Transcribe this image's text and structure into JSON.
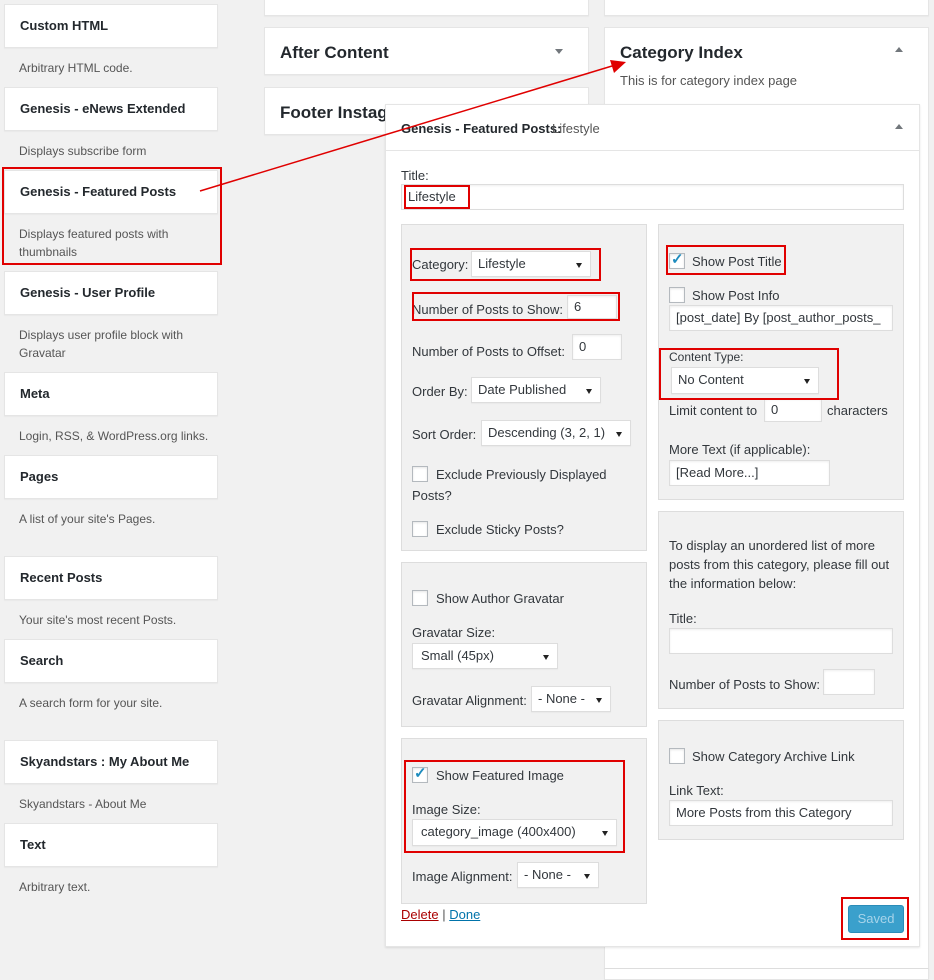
{
  "sidebar": {
    "widgets": [
      {
        "title": "Custom HTML",
        "desc": "Arbitrary HTML code."
      },
      {
        "title": "Genesis - eNews Extended",
        "desc": "Displays subscribe form"
      },
      {
        "title": "Genesis - Featured Posts",
        "desc": "Displays featured posts with thumbnails"
      },
      {
        "title": "Genesis - User Profile",
        "desc": "Displays user profile block with Gravatar"
      },
      {
        "title": "Meta",
        "desc": "Login, RSS, & WordPress.org links."
      },
      {
        "title": "Pages",
        "desc": "A list of your site's Pages."
      },
      {
        "title": "Recent Posts",
        "desc": "Your site's most recent Posts."
      },
      {
        "title": "Search",
        "desc": "A search form for your site."
      },
      {
        "title": "Skyandstars : My About Me",
        "desc": "Skyandstars - About Me"
      },
      {
        "title": "Text",
        "desc": "Arbitrary text."
      }
    ]
  },
  "areas": {
    "after_content": "After Content",
    "footer_instagram": "Footer Instagram",
    "category_index": "Category Index",
    "category_index_desc": "This is for category index page"
  },
  "panel": {
    "header": "Genesis - Featured Posts:",
    "header_value": "Lifestyle",
    "title_label": "Title:",
    "title_value": "Lifestyle",
    "category_label": "Category:",
    "category_value": "Lifestyle",
    "num_posts_label": "Number of Posts to Show:",
    "num_posts_value": "6",
    "offset_label": "Number of Posts to Offset:",
    "offset_value": "0",
    "order_by_label": "Order By:",
    "order_by_value": "Date Published",
    "sort_order_label": "Sort Order:",
    "sort_order_value": "Descending (3, 2, 1)",
    "exclude_prev_label_1": "Exclude Previously Displayed",
    "exclude_prev_label_2": "Posts?",
    "exclude_sticky_label": "Exclude Sticky Posts?",
    "show_gravatar_label": "Show Author Gravatar",
    "gravatar_size_label": "Gravatar Size:",
    "gravatar_size_value": "Small (45px)",
    "gravatar_align_label": "Gravatar Alignment:",
    "gravatar_align_value": "- None -",
    "show_featured_label": "Show Featured Image",
    "image_size_label": "Image Size:",
    "image_size_value": "category_image (400x400)",
    "image_align_label": "Image Alignment:",
    "image_align_value": "- None -",
    "show_post_title_label": "Show Post Title",
    "show_post_info_label": "Show Post Info",
    "post_info_value": "[post_date] By [post_author_posts_",
    "content_type_label": "Content Type:",
    "content_type_value": "No Content",
    "limit_label": "Limit content to",
    "limit_value": "0",
    "limit_suffix": "characters",
    "more_text_label": "More Text (if applicable):",
    "more_text_value": "[Read More...]",
    "more_list_desc_1": "To display an unordered list of more",
    "more_list_desc_2": "posts from this category, please fill out",
    "more_list_desc_3": "the information below:",
    "more_title_label": "Title:",
    "more_num_label": "Number of Posts to Show:",
    "archive_link_label": "Show Category Archive Link",
    "link_text_label": "Link Text:",
    "link_text_value": "More Posts from this Category",
    "delete_label": "Delete",
    "separator": "|",
    "done_label": "Done",
    "saved_label": "Saved"
  },
  "colors": {
    "annotation": "#e00000",
    "link": "#0073aa",
    "delete": "#a00000",
    "button": "#3aa0cc"
  }
}
